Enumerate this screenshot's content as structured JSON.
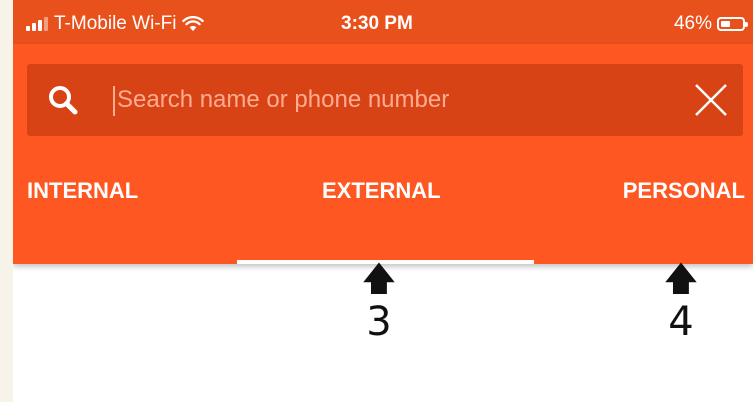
{
  "status_bar": {
    "carrier": "T-Mobile Wi-Fi",
    "time": "3:30 PM",
    "battery_percent_label": "46%",
    "battery_level": 0.46,
    "signal_icon": "signal-bars-icon",
    "wifi_icon": "wifi-icon",
    "battery_icon": "battery-icon",
    "background_color": "#e8501c"
  },
  "header": {
    "background_color": "#ff5722",
    "search": {
      "placeholder": "Search name or phone number",
      "value": "",
      "search_icon": "search-icon",
      "clear_icon": "close-icon",
      "background_color": "#d84315"
    },
    "tabs": [
      {
        "label": "INTERNAL",
        "selected": false
      },
      {
        "label": "EXTERNAL",
        "selected": true
      },
      {
        "label": "PERSONAL",
        "selected": false
      }
    ]
  },
  "annotations": [
    {
      "arrow": "🡅",
      "label": "3"
    },
    {
      "arrow": "🡅",
      "label": "4"
    }
  ]
}
